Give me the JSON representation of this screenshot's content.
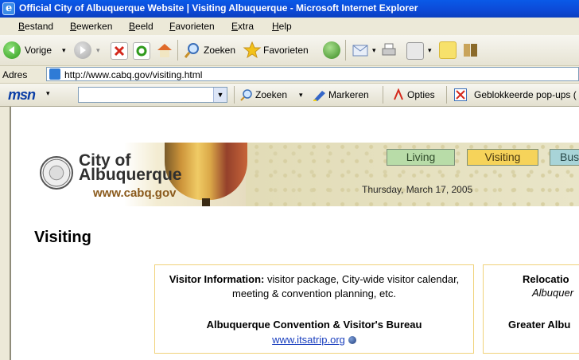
{
  "window": {
    "title": "Official City of Albuquerque Website | Visiting Albuquerque - Microsoft Internet Explorer"
  },
  "menu": {
    "items": [
      "Bestand",
      "Bewerken",
      "Beeld",
      "Favorieten",
      "Extra",
      "Help"
    ]
  },
  "toolbar": {
    "back_label": "Vorige",
    "search_label": "Zoeken",
    "favorites_label": "Favorieten"
  },
  "address": {
    "label": "Adres",
    "url": "http://www.cabq.gov/visiting.html"
  },
  "msn": {
    "logo": "msn",
    "search_label": "Zoeken",
    "highlight_label": "Markeren",
    "options_label": "Opties",
    "popups_label": "Geblokkeerde pop-ups ("
  },
  "banner": {
    "city_line1": "City of",
    "city_line2": "Albuquerque",
    "site_url": "www.cabq.gov",
    "tabs": [
      "Living",
      "Visiting",
      "Bus"
    ],
    "date": "Thursday, March 17, 2005"
  },
  "page": {
    "heading": "Visiting"
  },
  "boxes": {
    "visitor": {
      "bold": "Visitor Information:",
      "text": " visitor package, City-wide visitor calendar, meeting & convention planning, etc.",
      "org": "Albuquerque Convention & Visitor's Bureau",
      "link": "www.itsatrip.org"
    },
    "relocation": {
      "line1": "Relocatio",
      "line2": "Albuquer",
      "org": "Greater Albu"
    }
  },
  "colors": {
    "tab_living": "#b8dca8",
    "tab_visiting": "#f6d35a",
    "tab_bus": "#a8d4d8"
  }
}
